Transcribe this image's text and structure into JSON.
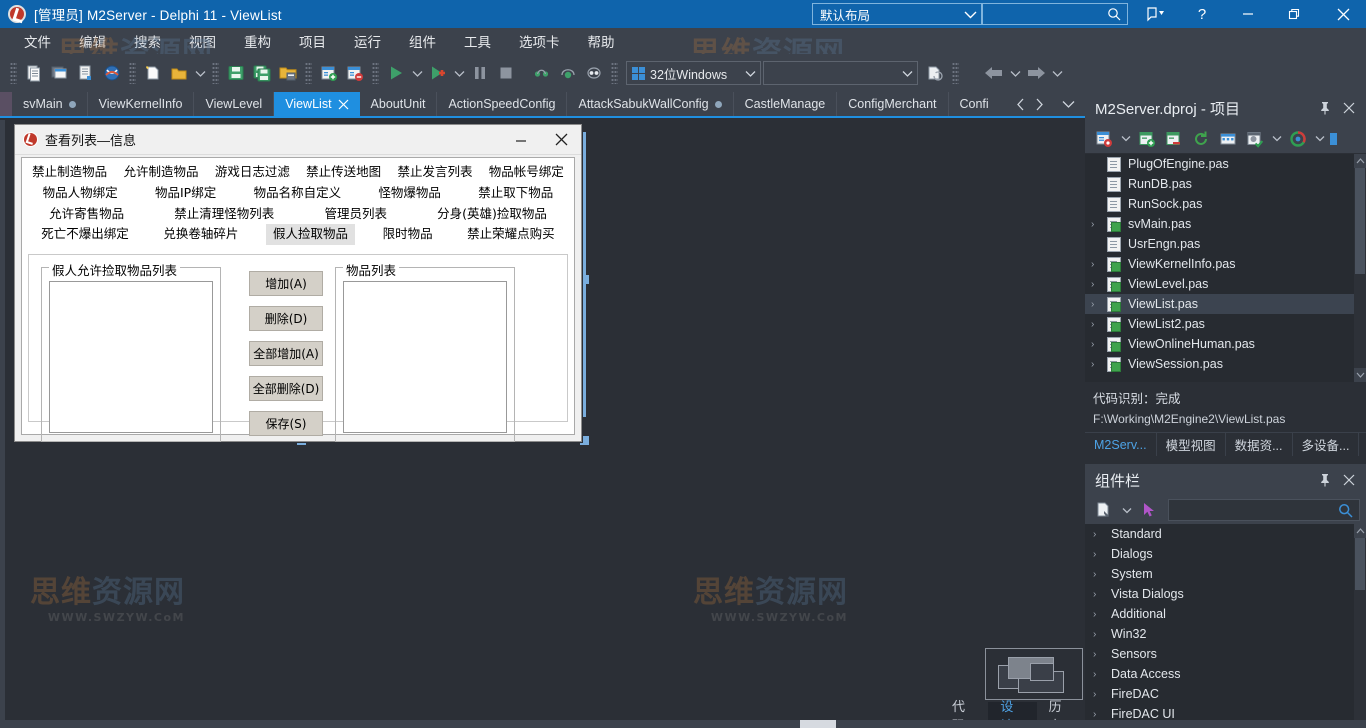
{
  "window": {
    "title": "[管理员] M2Server - Delphi 11 - ViewList",
    "logo_icon": "delphi-logo-icon",
    "layout_select": {
      "value": "默认布局",
      "icon": "chevron-down-icon"
    },
    "search": {
      "value": "",
      "placeholder": "",
      "icon": "search-icon"
    },
    "account_icon": "account-icon",
    "help_icon": "help-icon",
    "minimize_icon": "minimize-icon",
    "restore_icon": "restore-icon",
    "close_icon": "close-icon"
  },
  "menubar": {
    "items": [
      {
        "label": "文件"
      },
      {
        "label": "编辑"
      },
      {
        "label": "搜索"
      },
      {
        "label": "视图"
      },
      {
        "label": "重构"
      },
      {
        "label": "项目"
      },
      {
        "label": "运行"
      },
      {
        "label": "组件"
      },
      {
        "label": "工具"
      },
      {
        "label": "选项卡"
      },
      {
        "label": "帮助"
      }
    ]
  },
  "toolbar": {
    "icons": [
      "new-item-icon",
      "open-project-icon",
      "save-as-unit-icon",
      "browser-icon",
      "new-file-icon",
      "open-folder-icon",
      "save-icon",
      "save-all-icon",
      "open-project-group-icon",
      "add-to-project-icon",
      "remove-from-project-icon",
      "run-icon",
      "run-without-debugging-icon",
      "pause-icon",
      "stop-icon",
      "trace-into-icon",
      "step-over-icon",
      "run-to-cursor-icon"
    ],
    "platform": {
      "label": "32位Windows",
      "icon": "windows-logo-icon"
    },
    "config": {
      "value": "",
      "icon": "chevron-down-icon"
    },
    "refresh_icon": "refresh-config-icon",
    "nav_back_icon": "arrow-back-icon",
    "nav_forward_icon": "arrow-forward-icon"
  },
  "file_tabs": {
    "items": [
      {
        "label": "svMain",
        "modified": true,
        "active": false
      },
      {
        "label": "ViewKernelInfo",
        "modified": false,
        "active": false
      },
      {
        "label": "ViewLevel",
        "modified": false,
        "active": false
      },
      {
        "label": "ViewList",
        "modified": false,
        "active": true,
        "closable": true
      },
      {
        "label": "AboutUnit",
        "modified": false,
        "active": false
      },
      {
        "label": "ActionSpeedConfig",
        "modified": false,
        "active": false
      },
      {
        "label": "AttackSabukWallConfig",
        "modified": true,
        "active": false
      },
      {
        "label": "CastleManage",
        "modified": false,
        "active": false
      },
      {
        "label": "ConfigMerchant",
        "modified": false,
        "active": false
      },
      {
        "label": "Config",
        "modified": false,
        "active": false
      }
    ],
    "prev_icon": "chevron-left-icon",
    "next_icon": "chevron-right-icon",
    "list_icon": "chevron-down-icon"
  },
  "form": {
    "caption": "查看列表—信息",
    "icon": "app-logo-icon",
    "minimize_icon": "minimize-icon",
    "close_icon": "close-icon",
    "tab_rows": [
      [
        "禁止制造物品",
        "允许制造物品",
        "游戏日志过滤",
        "禁止传送地图",
        "禁止发言列表",
        "物品帐号绑定"
      ],
      [
        "物品人物绑定",
        "物品IP绑定",
        "物品名称自定义",
        "怪物爆物品",
        "禁止取下物品"
      ],
      [
        "允许寄售物品",
        "禁止清理怪物列表",
        "管理员列表",
        "分身(英雄)捡取物品"
      ],
      [
        "死亡不爆出绑定",
        "兑换卷轴碎片",
        "假人捡取物品",
        "限时物品",
        "禁止荣耀点购买"
      ]
    ],
    "selected_tab": "假人捡取物品",
    "left_group": {
      "label": "假人允许捡取物品列表",
      "items": []
    },
    "right_group": {
      "label": "物品列表",
      "items": []
    },
    "buttons": [
      {
        "label": "增加(A)"
      },
      {
        "label": "删除(D)"
      },
      {
        "label": "全部增加(A)"
      },
      {
        "label": "全部删除(D)"
      },
      {
        "label": "保存(S)"
      }
    ]
  },
  "view_switcher": {
    "tabs": [
      {
        "label": "代码",
        "selected": false
      },
      {
        "label": "设计",
        "selected": true
      },
      {
        "label": "历史",
        "selected": false
      }
    ],
    "preview_icon": "form-preview-icon"
  },
  "project_panel": {
    "title": "M2Server.dproj - 项目",
    "pin_icon": "pin-icon",
    "close_icon": "close-icon",
    "toolbar_icons": [
      "new-project-icon",
      "chevron-down-icon",
      "add-file-icon",
      "remove-file-icon",
      "refresh-icon",
      "build-icon",
      "options-icon",
      "chevron-down-icon",
      "view-mode-icon",
      "chevron-down-icon"
    ],
    "tree": [
      {
        "label": "PlugOfEngine.pas",
        "expandable": false,
        "type": "file"
      },
      {
        "label": "RunDB.pas",
        "expandable": false,
        "type": "file"
      },
      {
        "label": "RunSock.pas",
        "expandable": false,
        "type": "file"
      },
      {
        "label": "svMain.pas",
        "expandable": true,
        "type": "unit"
      },
      {
        "label": "UsrEngn.pas",
        "expandable": false,
        "type": "file"
      },
      {
        "label": "ViewKernelInfo.pas",
        "expandable": true,
        "type": "unit"
      },
      {
        "label": "ViewLevel.pas",
        "expandable": true,
        "type": "unit"
      },
      {
        "label": "ViewList.pas",
        "expandable": true,
        "type": "unit",
        "selected": true
      },
      {
        "label": "ViewList2.pas",
        "expandable": true,
        "type": "unit"
      },
      {
        "label": "ViewOnlineHuman.pas",
        "expandable": true,
        "type": "unit"
      },
      {
        "label": "ViewSession.pas",
        "expandable": true,
        "type": "unit"
      }
    ],
    "status": "代码识别：完成",
    "path": "F:\\Working\\M2Engine2\\ViewList.pas",
    "bottom_tabs": [
      {
        "label": "M2Serv...",
        "selected": true
      },
      {
        "label": "模型视图",
        "selected": false
      },
      {
        "label": "数据资...",
        "selected": false
      },
      {
        "label": "多设备...",
        "selected": false
      }
    ]
  },
  "palette_panel": {
    "title": "组件栏",
    "pin_icon": "pin-icon",
    "close_icon": "close-icon",
    "toolbar_icons": [
      "new-component-icon",
      "chevron-down-icon",
      "pointer-icon"
    ],
    "search": {
      "value": "",
      "placeholder": "",
      "icon": "search-icon"
    },
    "categories": [
      {
        "label": "Standard"
      },
      {
        "label": "Dialogs"
      },
      {
        "label": "System"
      },
      {
        "label": "Vista Dialogs"
      },
      {
        "label": "Additional"
      },
      {
        "label": "Win32"
      },
      {
        "label": "Sensors"
      },
      {
        "label": "Data Access"
      },
      {
        "label": "FireDAC"
      },
      {
        "label": "FireDAC UI"
      }
    ]
  },
  "watermark": {
    "line1_a": "思维",
    "line1_b": "资源网",
    "line2": "WWW.SWZYW.CoM"
  }
}
